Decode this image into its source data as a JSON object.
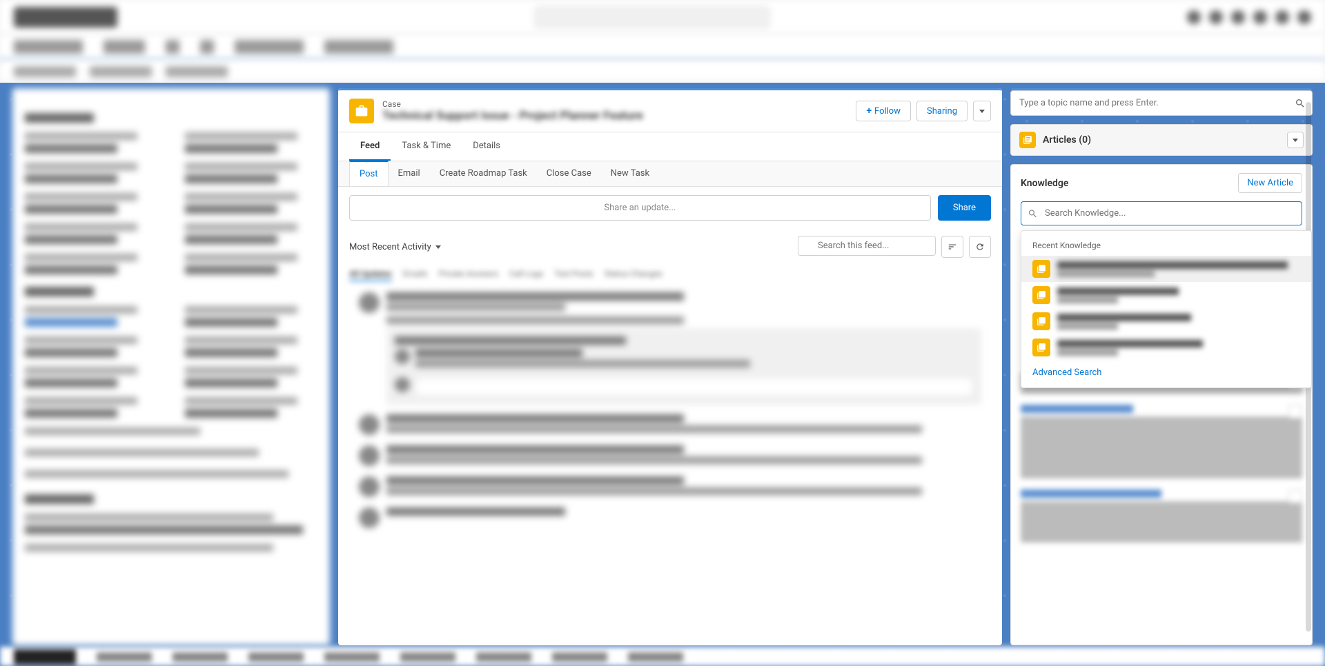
{
  "case": {
    "label": "Case",
    "title_blurred": "Technical Support Issue - Project Planner Feature",
    "follow": "Follow",
    "sharing": "Sharing"
  },
  "tabs": {
    "feed": "Feed",
    "task_time": "Task & Time",
    "details": "Details"
  },
  "quick_actions": {
    "post": "Post",
    "email": "Email",
    "create_roadmap": "Create Roadmap Task",
    "close_case": "Close Case",
    "new_task": "New Task"
  },
  "compose": {
    "placeholder": "Share an update...",
    "share": "Share"
  },
  "feed": {
    "sort": "Most Recent Activity",
    "search_placeholder": "Search this feed..."
  },
  "right": {
    "topic_placeholder": "Type a topic name and press Enter.",
    "articles_title": "Articles (0)",
    "knowledge_title": "Knowledge",
    "new_article": "New Article",
    "kn_search_placeholder": "Search Knowledge...",
    "recent_label": "Recent Knowledge",
    "advanced_search": "Advanced Search"
  }
}
